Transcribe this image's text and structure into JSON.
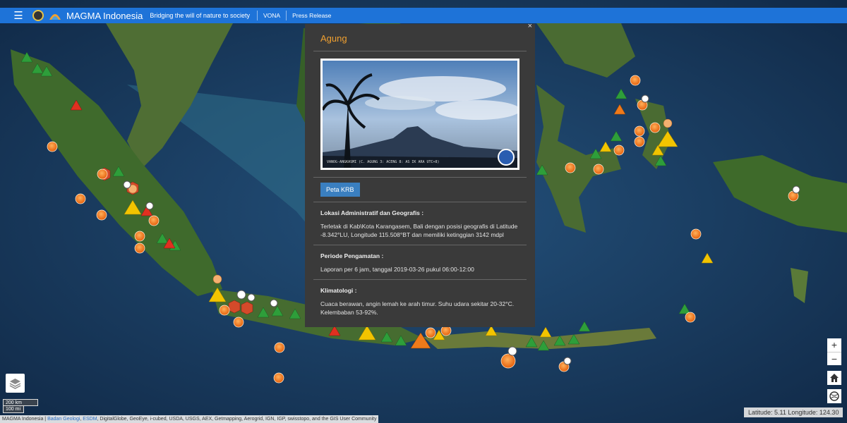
{
  "header": {
    "app_title": "MAGMA Indonesia",
    "tagline": "Bridging the will of nature to society",
    "nav": [
      "VONA",
      "Press Release"
    ]
  },
  "popup": {
    "volcano_name": "Agung",
    "close_label": "×",
    "photo_caption": "VANOG-ANGKASMI (C. AGUNG 3: ACENG 8: AS IK ARA UTC+8)",
    "button_label": "Peta KRB",
    "sections": [
      {
        "title": "Lokasi Administratif dan Geografis :",
        "body": "Terletak di Kab\\Kota Karangasem, Bali dengan posisi geografis di Latitude -8.342°LU, Longitude 115.508°BT dan memiliki ketinggian 3142 mdpl"
      },
      {
        "title": "Periode Pengamatan :",
        "body": "Laporan per 6 jam, tanggal 2019-03-26 pukul 06:00-12:00"
      },
      {
        "title": "Klimatologi :",
        "body": "Cuaca berawan, angin lemah ke arah timur. Suhu udara sekitar 20-32°C. Kelembaban 53-92%."
      }
    ]
  },
  "controls": {
    "zoom_in": "+",
    "zoom_out": "−"
  },
  "scale": {
    "km": "200 km",
    "mi": "100 mi"
  },
  "coords": "Latitude: 5.11 Longitude: 124.30",
  "attribution": {
    "prefix": "MAGMA Indonesia | ",
    "link1": "Badan Geologi",
    "sep": ", ",
    "link2": "ESDM",
    "rest": ", DigitalGlobe, GeoEye, i-cubed, USDA, USGS, AEX, Getmapping, Aerogrid, IGN, IGP, swisstopo, and the GIS User Community"
  },
  "colors": {
    "navbar": "#1e73d8",
    "popup_bg": "#3a3a3a",
    "title_orange": "#f0a030",
    "level_normal": "#2e9e3a",
    "level_waspada": "#f2c400",
    "level_siaga": "#f07a1a",
    "level_awas": "#e03020"
  }
}
